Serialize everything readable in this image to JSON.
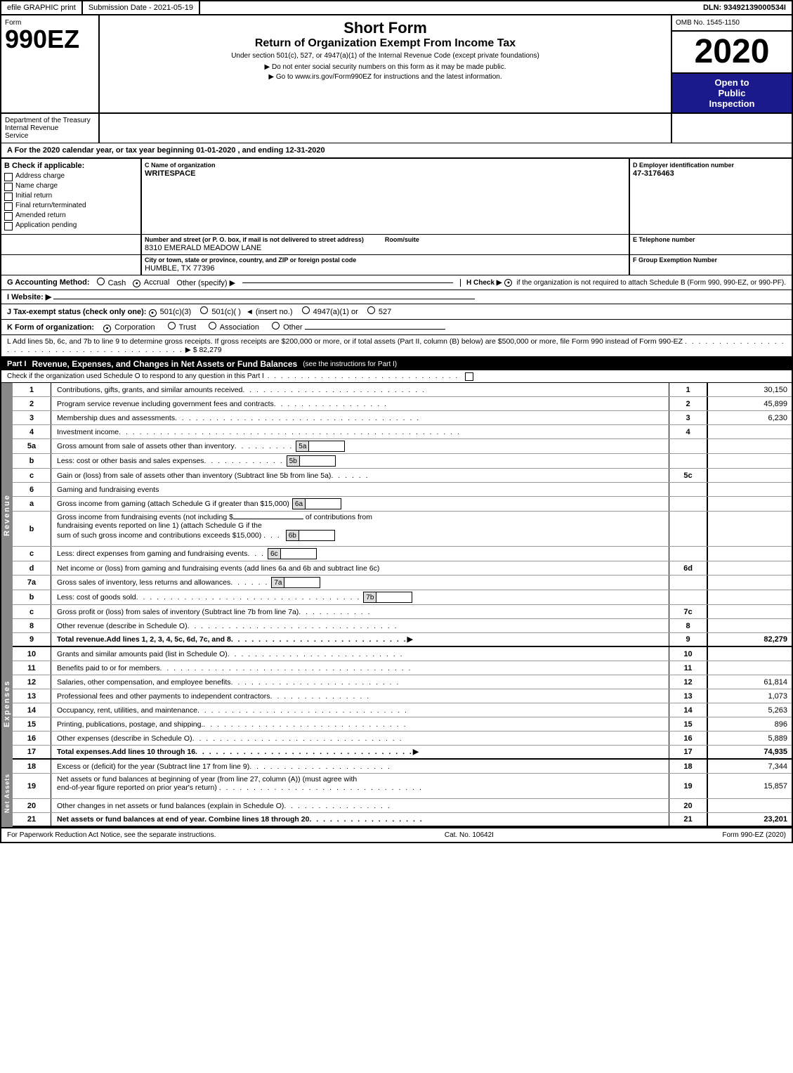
{
  "topbar": {
    "efile": "efile GRAPHIC print",
    "submission": "Submission Date - 2021-05-19",
    "dln_label": "DLN:",
    "dln": "93492139000534I"
  },
  "header": {
    "form_label": "Form",
    "form_number": "990EZ",
    "title1": "Short Form",
    "title2": "Return of Organization Exempt From Income Tax",
    "under_section": "Under section 501(c), 527, or 4947(a)(1) of the Internal Revenue Code (except private foundations)",
    "do_not_enter": "▶ Do not enter social security numbers on this form as it may be made public.",
    "goto": "▶ Go to www.irs.gov/Form990EZ for instructions and the latest information.",
    "omb": "OMB No. 1545-1150",
    "year": "2020",
    "open_to": "Open to",
    "public": "Public",
    "inspection": "Inspection",
    "dept1": "Department of the Treasury",
    "dept2": "Internal Revenue",
    "dept3": "Service"
  },
  "section_a": {
    "text": "A  For the 2020 calendar year, or tax year beginning 01-01-2020 , and ending 12-31-2020"
  },
  "section_b": {
    "label": "B Check if applicable:",
    "items": [
      {
        "label": "Address change",
        "checked": false
      },
      {
        "label": "Name change",
        "checked": false
      },
      {
        "label": "Initial return",
        "checked": false
      },
      {
        "label": "Final return/terminated",
        "checked": false
      },
      {
        "label": "Amended return",
        "checked": false
      },
      {
        "label": "Application pending",
        "checked": false
      }
    ]
  },
  "section_c": {
    "label": "C Name of organization",
    "org_name": "WRITESPACE",
    "street_label": "Number and street (or P. O. box, if mail is not delivered to street address)",
    "street": "8310 EMERALD MEADOW LANE",
    "room_label": "Room/suite",
    "room": "",
    "city_label": "City or town, state or province, country, and ZIP or foreign postal code",
    "city": "HUMBLE, TX  77396"
  },
  "section_d": {
    "label": "D Employer identification number",
    "ein": "47-3176463",
    "phone_label": "E Telephone number",
    "phone": "",
    "group_label": "F Group Exemption Number",
    "group_arrow": "▶"
  },
  "section_g": {
    "label": "G Accounting Method:",
    "cash": "Cash",
    "accrual": "Accrual",
    "other_label": "Other (specify) ▶",
    "accrual_checked": true
  },
  "section_h": {
    "label": "H  Check ▶",
    "checked": true,
    "text": "if the organization is not required to attach Schedule B (Form 990, 990-EZ, or 990-PF)."
  },
  "section_i": {
    "label": "I Website: ▶"
  },
  "section_j": {
    "label": "J Tax-exempt status (check only one):",
    "options": [
      {
        "label": "501(c)(3)",
        "checked": true
      },
      {
        "label": "501(c)(  )",
        "checked": false
      },
      {
        "label": "(insert no.)",
        "checked": false
      },
      {
        "label": "4947(a)(1) or",
        "checked": false
      },
      {
        "label": "527",
        "checked": false
      }
    ]
  },
  "section_k": {
    "label": "K Form of organization:",
    "options": [
      {
        "label": "Corporation",
        "checked": true
      },
      {
        "label": "Trust",
        "checked": false
      },
      {
        "label": "Association",
        "checked": false
      },
      {
        "label": "Other",
        "checked": false
      }
    ]
  },
  "section_l": {
    "text": "L Add lines 5b, 6c, and 7b to line 9 to determine gross receipts. If gross receipts are $200,000 or more, or if total assets (Part II, column (B) below) are $500,000 or more, file Form 990 instead of Form 990-EZ",
    "arrow": "▶ $",
    "value": "82,279"
  },
  "part_i": {
    "label": "Part I",
    "title": "Revenue, Expenses, and Changes in Net Assets or Fund Balances",
    "title_note": "(see the instructions for Part I)",
    "check_text": "Check if the organization used Schedule O to respond to any question in this Part I",
    "rows": [
      {
        "num": "1",
        "label": "Contributions, gifts, grants, and similar amounts received",
        "row_num": "1",
        "value": "30,150"
      },
      {
        "num": "2",
        "label": "Program service revenue including government fees and contracts",
        "row_num": "2",
        "value": "45,899"
      },
      {
        "num": "3",
        "label": "Membership dues and assessments",
        "row_num": "3",
        "value": "6,230"
      },
      {
        "num": "4",
        "label": "Investment income",
        "row_num": "4",
        "value": ""
      }
    ],
    "asset_rows": [
      {
        "num": "5a",
        "label": "Gross amount from sale of assets other than inventory",
        "box_label": "5a",
        "box_value": ""
      },
      {
        "num": "5b",
        "label": "Less: cost or other basis and sales expenses",
        "box_label": "5b",
        "box_value": ""
      },
      {
        "num": "5c",
        "label": "Gain or (loss) from sale of assets other than inventory (Subtract line 5b from line 5a)",
        "row_num": "5c",
        "value": ""
      }
    ],
    "gaming_rows": [
      {
        "num": "6",
        "label": "Gaming and fundraising events"
      },
      {
        "num": "6a",
        "label": "Gross income from gaming (attach Schedule G if greater than $15,000)",
        "box_label": "6a",
        "box_value": ""
      },
      {
        "num": "6b",
        "label_parts": [
          "Gross income from fundraising events (not including $",
          " of contributions from fundraising events reported on line 1) (attach Schedule G if the sum of such gross income and contributions exceeds $15,000)"
        ],
        "box_label": "6b",
        "box_value": ""
      },
      {
        "num": "6c",
        "label": "Less: direct expenses from gaming and fundraising events",
        "box_label": "6c",
        "box_value": ""
      },
      {
        "num": "6d",
        "label": "Net income or (loss) from gaming and fundraising events (add lines 6a and 6b and subtract line 6c)",
        "row_num": "6d",
        "value": ""
      }
    ],
    "inventory_rows": [
      {
        "num": "7a",
        "label": "Gross sales of inventory, less returns and allowances",
        "box_label": "7a",
        "box_value": ""
      },
      {
        "num": "7b",
        "label": "Less: cost of goods sold",
        "box_label": "7b",
        "box_value": ""
      },
      {
        "num": "7c",
        "label": "Gross profit or (loss) from sales of inventory (Subtract line 7b from line 7a)",
        "row_num": "7c",
        "value": ""
      }
    ],
    "other_rows": [
      {
        "num": "8",
        "label": "Other revenue (describe in Schedule O)",
        "row_num": "8",
        "value": ""
      },
      {
        "num": "9",
        "label": "Total revenue. Add lines 1, 2, 3, 4, 5c, 6d, 7c, and 8",
        "arrow": "▶",
        "row_num": "9",
        "value": "82,279",
        "bold": true
      }
    ]
  },
  "expenses": {
    "rows": [
      {
        "num": "10",
        "label": "Grants and similar amounts paid (list in Schedule O)",
        "row_num": "10",
        "value": ""
      },
      {
        "num": "11",
        "label": "Benefits paid to or for members",
        "row_num": "11",
        "value": ""
      },
      {
        "num": "12",
        "label": "Salaries, other compensation, and employee benefits",
        "row_num": "12",
        "value": "61,814"
      },
      {
        "num": "13",
        "label": "Professional fees and other payments to independent contractors",
        "row_num": "13",
        "value": "1,073"
      },
      {
        "num": "14",
        "label": "Occupancy, rent, utilities, and maintenance",
        "row_num": "14",
        "value": "5,263"
      },
      {
        "num": "15",
        "label": "Printing, publications, postage, and shipping.",
        "row_num": "15",
        "value": "896"
      },
      {
        "num": "16",
        "label": "Other expenses (describe in Schedule O)",
        "row_num": "16",
        "value": "5,889"
      },
      {
        "num": "17",
        "label": "Total expenses. Add lines 10 through 16",
        "arrow": "▶",
        "row_num": "17",
        "value": "74,935",
        "bold": true
      }
    ]
  },
  "net_assets": {
    "rows": [
      {
        "num": "18",
        "label": "Excess or (deficit) for the year (Subtract line 17 from line 9)",
        "row_num": "18",
        "value": "7,344"
      },
      {
        "num": "19",
        "label": "Net assets or fund balances at beginning of year (from line 27, column (A)) (must agree with end-of-year figure reported on prior year's return)",
        "row_num": "19",
        "value": "15,857"
      },
      {
        "num": "20",
        "label": "Other changes in net assets or fund balances (explain in Schedule O)",
        "row_num": "20",
        "value": ""
      },
      {
        "num": "21",
        "label": "Net assets or fund balances at end of year. Combine lines 18 through 20",
        "row_num": "21",
        "value": "23,201",
        "bold": true
      }
    ]
  },
  "footer": {
    "paperwork": "For Paperwork Reduction Act Notice, see the separate instructions.",
    "cat_no": "Cat. No. 10642I",
    "form_ref": "Form 990-EZ (2020)"
  }
}
